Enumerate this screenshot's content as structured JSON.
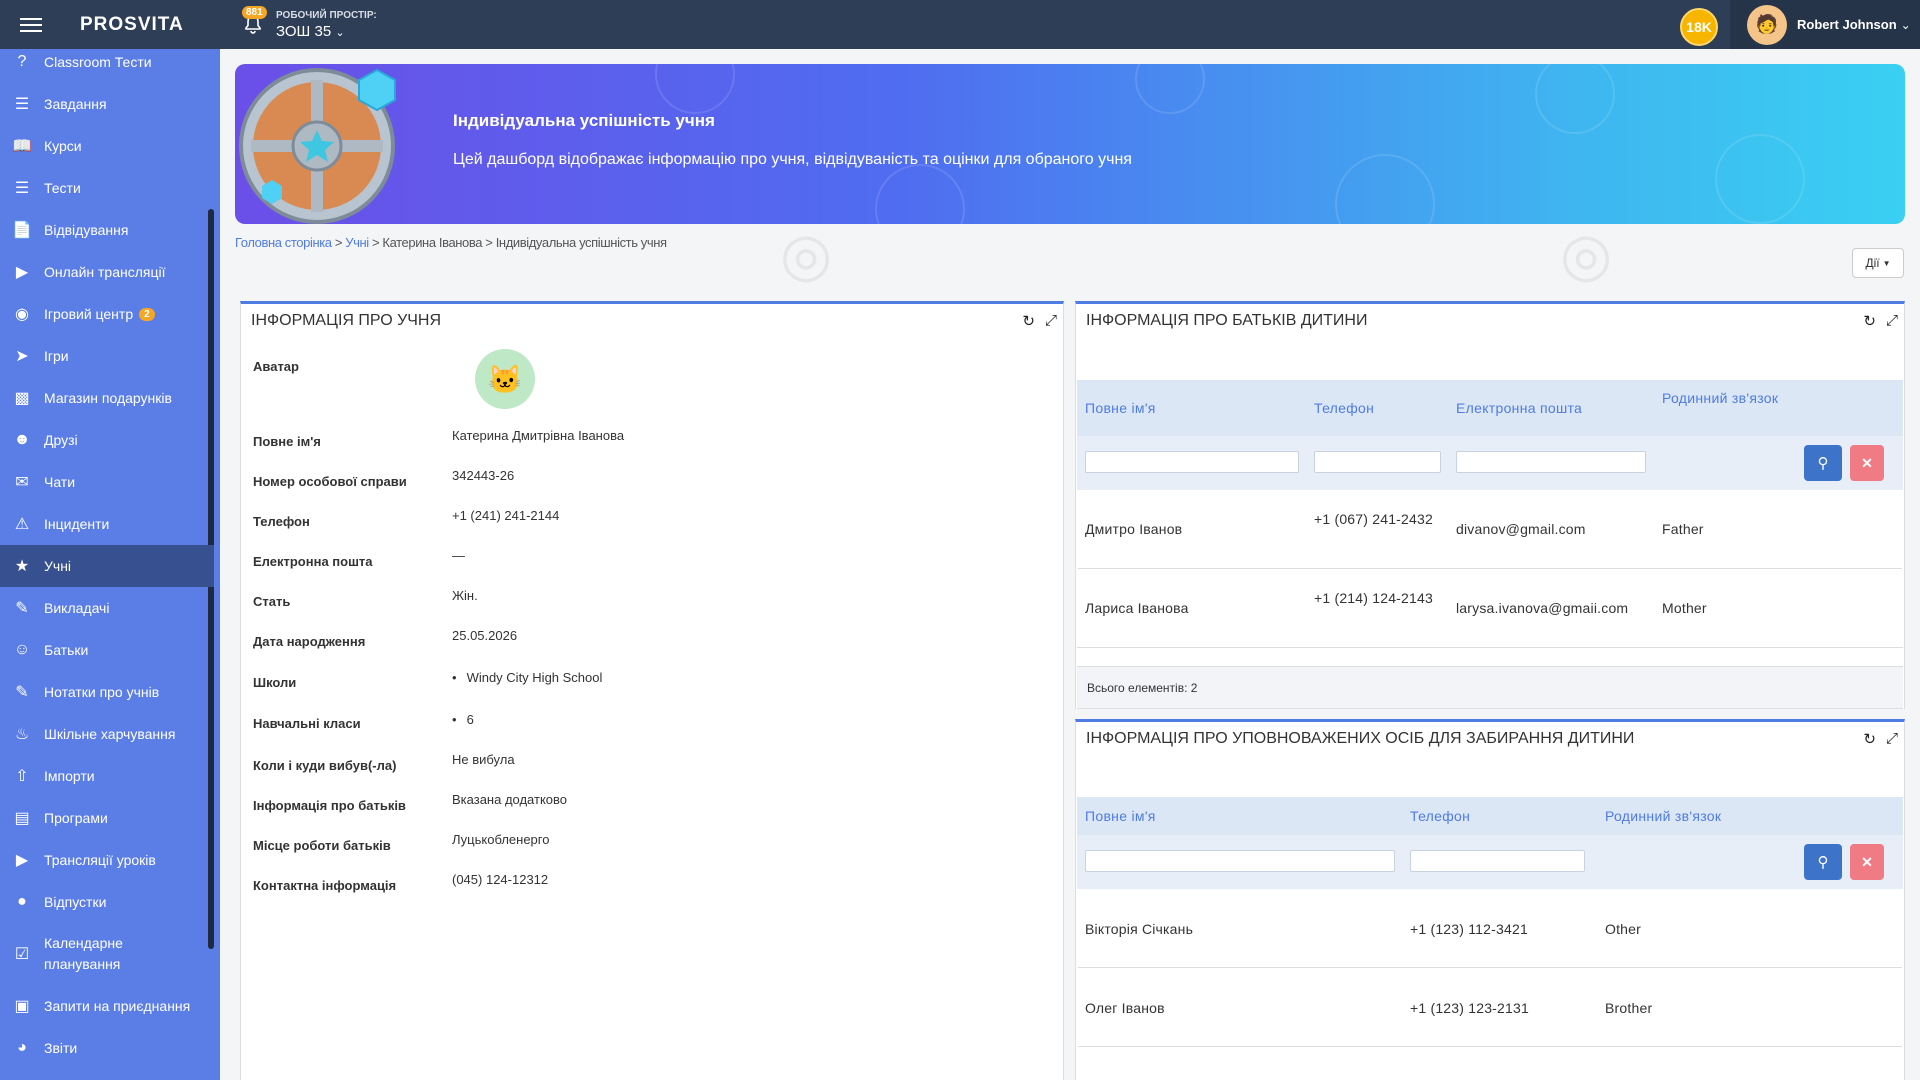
{
  "topbar": {
    "logo": "PROSVITA",
    "notifications_count": "881",
    "workspace_label": "РОБОЧИЙ ПРОСТІР:",
    "workspace_value": "ЗОШ 35",
    "coins": "18K",
    "user_name": "Robert Johnson"
  },
  "sidebar": {
    "items": [
      {
        "label": "Classroom Тести",
        "icon": "question-icon"
      },
      {
        "label": "Завдання",
        "icon": "tasks-icon"
      },
      {
        "label": "Курси",
        "icon": "courses-icon"
      },
      {
        "label": "Тести",
        "icon": "list-icon"
      },
      {
        "label": "Відвідування",
        "icon": "attendance-icon"
      },
      {
        "label": "Онлайн трансляції",
        "icon": "video-icon"
      },
      {
        "label": "Ігровий центр",
        "icon": "gamepad-icon",
        "badge": "2"
      },
      {
        "label": "Ігри",
        "icon": "rocket-icon"
      },
      {
        "label": "Магазин подарунків",
        "icon": "gift-icon"
      },
      {
        "label": "Друзі",
        "icon": "friends-icon"
      },
      {
        "label": "Чати",
        "icon": "chat-icon"
      },
      {
        "label": "Інциденти",
        "icon": "warning-icon"
      },
      {
        "label": "Учні",
        "icon": "students-icon",
        "active": true
      },
      {
        "label": "Викладачі",
        "icon": "teachers-icon"
      },
      {
        "label": "Батьки",
        "icon": "parents-icon"
      },
      {
        "label": "Нотатки про учнів",
        "icon": "notes-icon"
      },
      {
        "label": "Шкільне харчування",
        "icon": "food-icon"
      },
      {
        "label": "Імпорти",
        "icon": "upload-icon"
      },
      {
        "label": "Програми",
        "icon": "programs-icon"
      },
      {
        "label": "Трансляції уроків",
        "icon": "video-icon"
      },
      {
        "label": "Відпустки",
        "icon": "vacation-icon"
      },
      {
        "label": "Календарне планування",
        "icon": "calendar-icon"
      },
      {
        "label": "Запити на приєднання",
        "icon": "id-card-icon"
      },
      {
        "label": "Звіти",
        "icon": "pie-chart-icon"
      }
    ]
  },
  "banner": {
    "title": "Індивідуальна успішність учня",
    "subtitle": "Цей дашборд відображає інформацію про учня, відвідуваність та оцінки для обраного учня"
  },
  "breadcrumb": {
    "home": "Головна сторінка",
    "students": "Учні",
    "student": "Катерина Іванова",
    "current": "Індивідуальна успішність учня",
    "sep": " > "
  },
  "actions_label": "Дії",
  "student_panel": {
    "title": "ІНФОРМАЦІЯ ПРО УЧНЯ",
    "fields": [
      {
        "label": "Аватар",
        "value": ""
      },
      {
        "label": "Повне ім'я",
        "value": "Катерина Дмитрівна Іванова"
      },
      {
        "label": "Номер особової справи",
        "value": "342443-26"
      },
      {
        "label": "Телефон",
        "value": "+1 (241) 241-2144"
      },
      {
        "label": "Електронна пошта",
        "value": "—"
      },
      {
        "label": "Стать",
        "value": "Жін."
      },
      {
        "label": "Дата народження",
        "value": "25.05.2026"
      },
      {
        "label": "Школи",
        "value": "Windy City High School"
      },
      {
        "label": "Навчальні класи",
        "value": "6"
      },
      {
        "label": "Коли і куди вибув(-ла)",
        "value": "Не вибула"
      },
      {
        "label": "Інформація про батьків",
        "value": "Вказана додатково"
      },
      {
        "label": "Місце роботи батьків",
        "value": "Луцькобленерго"
      },
      {
        "label": "Контактна інформація",
        "value": "(045) 124-12312"
      }
    ]
  },
  "parents_panel": {
    "title": "ІНФОРМАЦІЯ ПРО БАТЬКІВ ДИТИНИ",
    "columns": [
      "Повне ім'я",
      "Телефон",
      "Електронна пошта",
      "Родинний зв'язок"
    ],
    "rows": [
      {
        "name": "Дмитро Іванов",
        "phone": "+1 (067) 241-2432",
        "email": "divanov@gmail.com",
        "relation": "Father"
      },
      {
        "name": "Лариса Іванова",
        "phone": "+1 (214) 124-2143",
        "email": "larysa.ivanova@gmaii.com",
        "relation": "Mother"
      }
    ],
    "total": "Всього елементів: 2"
  },
  "pickup_panel": {
    "title": "ІНФОРМАЦІЯ ПРО УПОВНОВАЖЕНИХ ОСІБ ДЛЯ ЗАБИРАННЯ ДИТИНИ",
    "columns": [
      "Повне ім'я",
      "Телефон",
      "Родинний зв'язок"
    ],
    "rows": [
      {
        "name": "Вікторія Січкань",
        "phone": "+1 (123) 112-3421",
        "relation": "Other"
      },
      {
        "name": "Олег Іванов",
        "phone": "+1 (123) 123-2131",
        "relation": "Brother"
      }
    ]
  },
  "colors": {
    "accent": "#4f7ce3",
    "sidebar": "#5b7ee6",
    "topbar": "#2e3e57"
  }
}
